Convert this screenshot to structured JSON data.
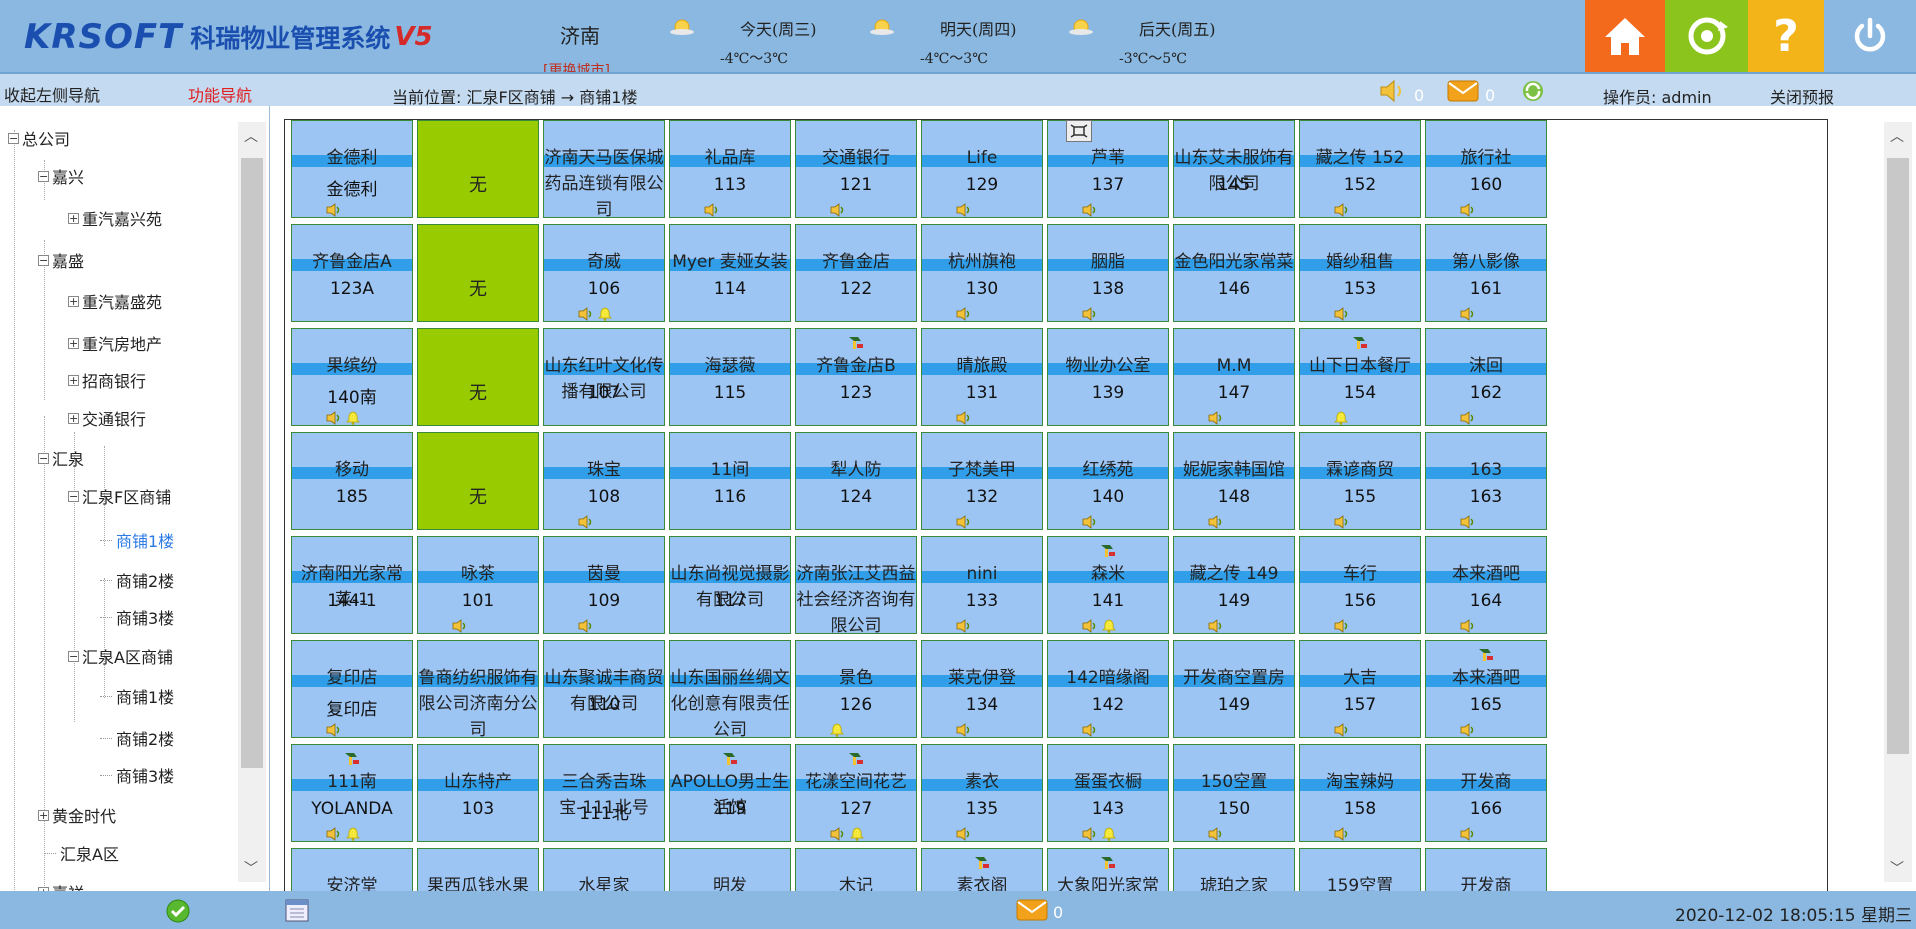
{
  "header": {
    "logo_brand": "KRSOFT",
    "logo_title": "科瑞物业管理系统",
    "logo_suffix": "V5",
    "city": "济南",
    "city_change": "[更换城市]",
    "weather": [
      {
        "day": "今天(周三)",
        "temp": "-4℃～3℃"
      },
      {
        "day": "明天(周四)",
        "temp": "-4℃～3℃"
      },
      {
        "day": "后天(周五)",
        "temp": "-3℃～5℃"
      }
    ],
    "buttons": {
      "home": "home",
      "refresh": "refresh",
      "help": "help",
      "power": "power"
    },
    "colors": {
      "home": "#f46a1c",
      "refresh": "#8bc41c",
      "help": "#f3b41a",
      "header_bg": "#8ab8e0"
    }
  },
  "navbar": {
    "collapse": "收起左侧导航",
    "function_nav": "功能导航",
    "location": "当前位置:  汇泉F区商铺 → 商铺1楼",
    "speaker_count": "0",
    "mail_count": "0",
    "operator": "操作员:   admin",
    "close_warning": "关闭预报"
  },
  "tree": [
    {
      "label": "总公司",
      "expander": "−"
    },
    {
      "label": "嘉兴",
      "expander": "−"
    },
    {
      "label": "重汽嘉兴苑",
      "expander": "+"
    },
    {
      "label": "嘉盛",
      "expander": "−"
    },
    {
      "label": "重汽嘉盛苑",
      "expander": "+"
    },
    {
      "label": "重汽房地产",
      "expander": "+"
    },
    {
      "label": "招商银行",
      "expander": "+"
    },
    {
      "label": "交通银行",
      "expander": "+"
    },
    {
      "label": "汇泉",
      "expander": "−"
    },
    {
      "label": "汇泉F区商铺",
      "expander": "−"
    },
    {
      "label": "商铺1楼",
      "expander": ""
    },
    {
      "label": "商铺2楼",
      "expander": ""
    },
    {
      "label": "商铺3楼",
      "expander": ""
    },
    {
      "label": "汇泉A区商铺",
      "expander": "−"
    },
    {
      "label": "商铺1楼",
      "expander": ""
    },
    {
      "label": "商铺2楼",
      "expander": ""
    },
    {
      "label": "商铺3楼",
      "expander": ""
    },
    {
      "label": "黄金时代",
      "expander": "+"
    },
    {
      "label": "汇泉A区",
      "expander": ""
    },
    {
      "label": "嘉祥",
      "expander": "+"
    }
  ],
  "grid": {
    "none_label": "无",
    "colors": {
      "cell": "#9cc5f4",
      "none": "#99cc00",
      "band": "#1e96e6"
    },
    "rows": [
      [
        {
          "name": "金德利",
          "room": "金德利",
          "band": true,
          "icons": [
            "sound"
          ]
        },
        {
          "none": true
        },
        {
          "name": "济南天马医保城药品连锁有限公司",
          "room": "",
          "band": true,
          "icons": []
        },
        {
          "name": "礼品库",
          "room": "113",
          "band": true,
          "icons": [
            "sound"
          ]
        },
        {
          "name": "交通银行",
          "room": "121",
          "band": true,
          "icons": [
            "sound"
          ]
        },
        {
          "name": "Life",
          "room": "129",
          "band": true,
          "icons": [
            "sound"
          ]
        },
        {
          "name": "芦苇",
          "room": "137",
          "band": true,
          "icons": [
            "sound"
          ]
        },
        {
          "name": "山东艾未服饰有限公司",
          "room": "145",
          "band": true,
          "icons": []
        },
        {
          "name": "藏之传 152",
          "room": "152",
          "band": true,
          "icons": [
            "sound"
          ]
        },
        {
          "name": "旅行社",
          "room": "160",
          "band": true,
          "icons": [
            "sound"
          ]
        }
      ],
      [
        {
          "name": "齐鲁金店A",
          "room": "123A",
          "band": true,
          "icons": []
        },
        {
          "none": true
        },
        {
          "name": "奇威",
          "room": "106",
          "band": true,
          "icons": [
            "sound",
            "bell"
          ]
        },
        {
          "name": "Myer 麦娅女装",
          "room": "114",
          "band": true,
          "icons": []
        },
        {
          "name": "齐鲁金店",
          "room": "122",
          "band": true,
          "icons": []
        },
        {
          "name": "杭州旗袍",
          "room": "130",
          "band": true,
          "icons": [
            "sound"
          ]
        },
        {
          "name": "胭脂",
          "room": "138",
          "band": true,
          "icons": [
            "sound"
          ]
        },
        {
          "name": "金色阳光家常菜",
          "room": "146",
          "band": true,
          "icons": []
        },
        {
          "name": "婚纱租售",
          "room": "153",
          "band": true,
          "icons": [
            "sound"
          ]
        },
        {
          "name": "第八影像",
          "room": "161",
          "band": true,
          "icons": [
            "sound"
          ]
        }
      ],
      [
        {
          "name": "果缤纷",
          "room": "140南",
          "band": true,
          "icons": [
            "sound",
            "bell"
          ]
        },
        {
          "none": true
        },
        {
          "name": "山东红叶文化传播有限公司",
          "room": "107",
          "band": true,
          "icons": []
        },
        {
          "name": "海瑟薇",
          "room": "115",
          "band": true,
          "icons": []
        },
        {
          "name": "齐鲁金店B",
          "room": "123",
          "band": true,
          "icons": [],
          "tools": true
        },
        {
          "name": "晴旅殿",
          "room": "131",
          "band": true,
          "icons": [
            "sound"
          ]
        },
        {
          "name": "物业办公室",
          "room": "139",
          "band": true,
          "icons": []
        },
        {
          "name": "M.M",
          "room": "147",
          "band": true,
          "icons": [
            "sound"
          ]
        },
        {
          "name": "山下日本餐厅",
          "room": "154",
          "band": true,
          "icons": [
            "bell"
          ],
          "tools": true
        },
        {
          "name": "沫回",
          "room": "162",
          "band": true,
          "icons": [
            "sound"
          ]
        }
      ],
      [
        {
          "name": "移动",
          "room": "185",
          "band": true,
          "icons": []
        },
        {
          "none": true
        },
        {
          "name": "珠宝",
          "room": "108",
          "band": true,
          "icons": [
            "sound"
          ]
        },
        {
          "name": "11间",
          "room": "116",
          "band": true,
          "icons": []
        },
        {
          "name": "犁人防",
          "room": "124",
          "band": true,
          "icons": []
        },
        {
          "name": "子梵美甲",
          "room": "132",
          "band": true,
          "icons": [
            "sound"
          ]
        },
        {
          "name": "红绣苑",
          "room": "140",
          "band": true,
          "icons": [
            "sound"
          ]
        },
        {
          "name": "妮妮家韩国馆",
          "room": "148",
          "band": true,
          "icons": [
            "sound"
          ]
        },
        {
          "name": "霖谚商贸",
          "room": "155",
          "band": true,
          "icons": [
            "sound"
          ]
        },
        {
          "name": "163",
          "room": "163",
          "band": true,
          "icons": [
            "sound"
          ]
        }
      ],
      [
        {
          "name": "济南阳光家常菜-1",
          "room": "144-1",
          "band": true,
          "icons": []
        },
        {
          "name": "咏茶",
          "room": "101",
          "band": true,
          "icons": [
            "sound"
          ]
        },
        {
          "name": "茵曼",
          "room": "109",
          "band": true,
          "icons": [
            "sound"
          ]
        },
        {
          "name": "山东尚视觉摄影有限公司",
          "room": "117",
          "band": true,
          "icons": []
        },
        {
          "name": "济南张江艾西益社会经济咨询有限公司",
          "room": "",
          "band": true,
          "icons": []
        },
        {
          "name": "nini",
          "room": "133",
          "band": true,
          "icons": [
            "sound"
          ]
        },
        {
          "name": "森米",
          "room": "141",
          "band": true,
          "icons": [
            "sound",
            "bell"
          ],
          "tools": true
        },
        {
          "name": "藏之传 149",
          "room": "149",
          "band": true,
          "icons": [
            "sound"
          ]
        },
        {
          "name": "车行",
          "room": "156",
          "band": true,
          "icons": [
            "sound"
          ]
        },
        {
          "name": "本来酒吧",
          "room": "164",
          "band": true,
          "icons": [
            "sound"
          ]
        }
      ],
      [
        {
          "name": "复印店",
          "room": "复印店",
          "band": true,
          "icons": [
            "sound"
          ]
        },
        {
          "name": "鲁商纺织服饰有限公司济南分公司",
          "room": "",
          "band": true,
          "icons": []
        },
        {
          "name": "山东聚诚丰商贸有限公司",
          "room": "110",
          "band": true,
          "icons": []
        },
        {
          "name": "山东国丽丝绸文化创意有限责任公司",
          "room": "",
          "band": true,
          "icons": []
        },
        {
          "name": "景色",
          "room": "126",
          "band": true,
          "icons": [
            "bell"
          ]
        },
        {
          "name": "莱克伊登",
          "room": "134",
          "band": true,
          "icons": [
            "sound"
          ]
        },
        {
          "name": "142暗缘阁",
          "room": "142",
          "band": true,
          "icons": [
            "sound"
          ]
        },
        {
          "name": "开发商空置房",
          "room": "149",
          "band": true,
          "icons": []
        },
        {
          "name": "大吉",
          "room": "157",
          "band": true,
          "icons": [
            "sound"
          ]
        },
        {
          "name": "本来酒吧",
          "room": "165",
          "band": true,
          "icons": [
            "sound"
          ],
          "tools": true
        }
      ],
      [
        {
          "name": "111南",
          "room": "YOLANDA",
          "band": true,
          "icons": [
            "sound",
            "bell"
          ],
          "tools": true
        },
        {
          "name": "山东特产",
          "room": "103",
          "band": true,
          "icons": []
        },
        {
          "name": "三合秀吉珠宝-111北号",
          "room": "111北",
          "band": true,
          "icons": []
        },
        {
          "name": "APOLLO男士生活馆",
          "room": "119",
          "band": true,
          "icons": [],
          "tools": true
        },
        {
          "name": "花漾空间花艺",
          "room": "127",
          "band": true,
          "icons": [
            "sound",
            "bell"
          ],
          "tools": true
        },
        {
          "name": "素衣",
          "room": "135",
          "band": true,
          "icons": [
            "sound"
          ]
        },
        {
          "name": "蛋蛋衣橱",
          "room": "143",
          "band": true,
          "icons": [
            "sound",
            "bell"
          ]
        },
        {
          "name": "150空置",
          "room": "150",
          "band": true,
          "icons": [
            "sound"
          ]
        },
        {
          "name": "淘宝辣妈",
          "room": "158",
          "band": true,
          "icons": [
            "sound"
          ]
        },
        {
          "name": "开发商",
          "room": "166",
          "band": true,
          "icons": [
            "sound"
          ]
        }
      ],
      [
        {
          "name": "安济堂",
          "room": "",
          "band": false,
          "icons": []
        },
        {
          "name": "果西瓜钱水果",
          "room": "",
          "band": false,
          "icons": []
        },
        {
          "name": "水星家",
          "room": "",
          "band": false,
          "icons": []
        },
        {
          "name": "明发",
          "room": "",
          "band": false,
          "icons": []
        },
        {
          "name": "木记",
          "room": "",
          "band": false,
          "icons": []
        },
        {
          "name": "素衣阁",
          "room": "",
          "band": false,
          "icons": [],
          "tools": true
        },
        {
          "name": "大象阳光家常",
          "room": "",
          "band": false,
          "icons": [],
          "tools": true
        },
        {
          "name": "琥珀之家",
          "room": "",
          "band": false,
          "icons": []
        },
        {
          "name": "159空置",
          "room": "",
          "band": false,
          "icons": []
        },
        {
          "name": "开发商",
          "room": "",
          "band": false,
          "icons": []
        }
      ]
    ]
  },
  "statusbar": {
    "mail_count": "0",
    "clock": "2020-12-02 18:05:15 星期三"
  }
}
